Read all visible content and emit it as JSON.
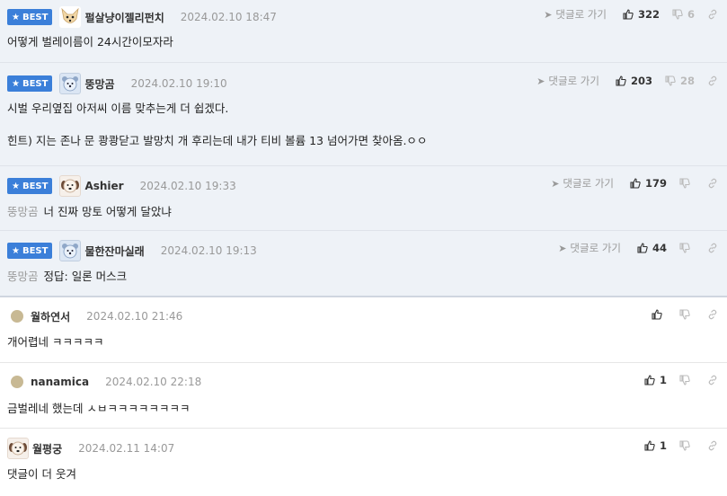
{
  "best_label": "BEST",
  "goto_label": "댓글로 가기",
  "comments": [
    {
      "nick": "펄살냥이젤리펀치",
      "time": "2024.02.10 18:47",
      "likes": "322",
      "dislikes": "6",
      "text": "어떻게 벌레이름이 24시간이모자라"
    },
    {
      "nick": "뚱망곰",
      "time": "2024.02.10 19:10",
      "likes": "203",
      "dislikes": "28",
      "text": "시벌 우리옆집 아저씨 이름 맞추는게 더 쉽겠다.",
      "text2": "힌트) 지는 존나 문 쾅쾅닫고 발망치 개 후리는데 내가 티비 볼륨 13 넘어가면 찾아옴.ㅇㅇ"
    },
    {
      "nick": "Ashier",
      "time": "2024.02.10 19:33",
      "likes": "179",
      "mention": "뚱망곰",
      "text": "너 진짜 망토 어떻게 달았냐"
    },
    {
      "nick": "물한잔마실래",
      "time": "2024.02.10 19:13",
      "likes": "44",
      "mention": "뚱망곰",
      "text": "정답: 일론 머스크"
    },
    {
      "nick": "월하연서",
      "time": "2024.02.10 21:46",
      "text": "개어렵네 ㅋㅋㅋㅋㅋ"
    },
    {
      "nick": "nanamica",
      "time": "2024.02.10 22:18",
      "likes": "1",
      "text": "금벌레네 했는데 ㅅㅂㅋㅋㅋㅋㅋㅋㅋㅋ"
    },
    {
      "nick": "월평궁",
      "time": "2024.02.11 14:07",
      "likes": "1",
      "text": "댓글이 더 웃겨"
    }
  ],
  "colors": {
    "best_badge": "#3b7fd9",
    "best_bg": "#eef2f7"
  },
  "icons": [
    "star-icon",
    "send-arrow-icon",
    "thumbs-up-icon",
    "thumbs-down-icon",
    "link-icon"
  ]
}
